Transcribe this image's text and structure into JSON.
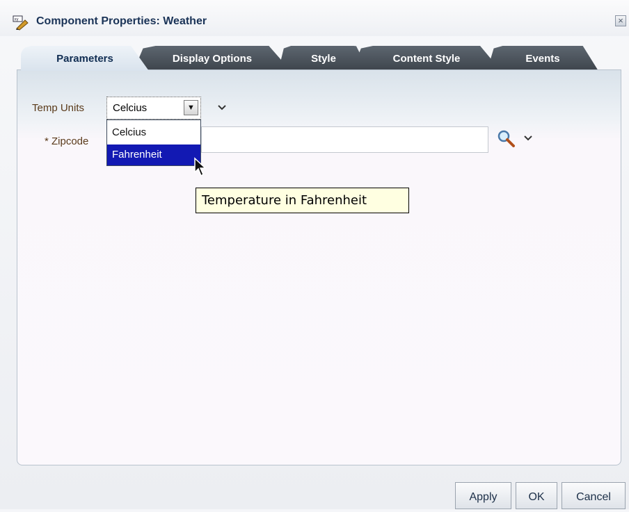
{
  "window": {
    "title": "Component Properties: Weather"
  },
  "tabs": [
    "Parameters",
    "Display Options",
    "Style",
    "Content Style",
    "Events"
  ],
  "form": {
    "temp_units": {
      "label": "Temp Units",
      "value": "Celcius",
      "options": [
        "Celcius",
        "Fahrenheit"
      ],
      "highlighted": "Fahrenheit"
    },
    "zipcode": {
      "label": "* Zipcode",
      "value": ""
    }
  },
  "tooltip": "Temperature in Fahrenheit",
  "buttons": {
    "apply": "Apply",
    "ok": "OK",
    "cancel": "Cancel"
  },
  "icons": {
    "title": "edit-properties-icon",
    "close": "close-icon",
    "search": "search-icon",
    "chevron": "chevron-down-icon"
  }
}
